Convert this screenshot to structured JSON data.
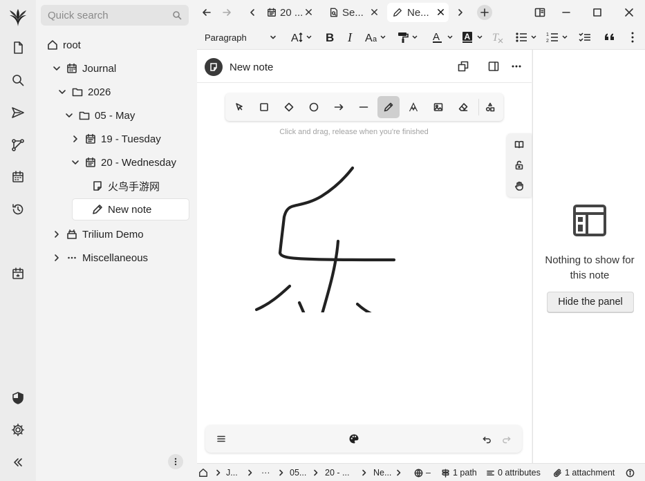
{
  "search": {
    "placeholder": "Quick search"
  },
  "tree": {
    "root": "root",
    "journal": "Journal",
    "year": "2026",
    "month": "05 - May",
    "day19": "19 - Tuesday",
    "day20": "20 - Wednesday",
    "note_cn": "火鸟手游网",
    "new_note": "New note",
    "trilium_demo": "Trilium Demo",
    "misc": "Miscellaneous"
  },
  "tabs": [
    {
      "label": "20 ..."
    },
    {
      "label": "Se..."
    },
    {
      "label": "Ne..."
    }
  ],
  "format": {
    "paragraph": "Paragraph"
  },
  "note": {
    "title": "New note"
  },
  "canvas": {
    "hint": "Click and drag, release when you're finished"
  },
  "right_panel": {
    "empty_text": "Nothing to show for this note",
    "hide_button": "Hide the panel"
  },
  "status": {
    "crumb1": "J...",
    "crumb2": "···",
    "crumb3": "05...",
    "crumb4": "20 - ...",
    "crumb5": "Ne...",
    "lang": "–",
    "paths": "1 path",
    "attributes": "0 attributes",
    "attachments": "1 attachment"
  },
  "colors": {
    "accent_dark": "#3a3a3a",
    "selected_tool": "#cfcfcf",
    "stroke": "#222222"
  }
}
